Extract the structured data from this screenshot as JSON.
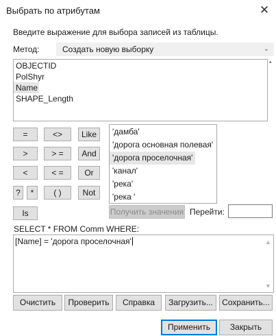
{
  "window": {
    "title": "Выбрать по атрибутам",
    "close_symbol": "✕"
  },
  "description": "Введите выражение для выбора записей из таблицы.",
  "method": {
    "label": "Метод:",
    "value": "Создать новую выборку"
  },
  "fields": {
    "items": [
      "OBJECTID",
      "PolShyr",
      "Name",
      "SHAPE_Length"
    ],
    "selected_index": 2
  },
  "operators": {
    "eq": "=",
    "ne": "<>",
    "like": "Like",
    "gt": ">",
    "ge": "> =",
    "and": "And",
    "lt": "<",
    "le": "< =",
    "or": "Or",
    "q": "?",
    "star": "*",
    "paren": "( )",
    "not": "Not",
    "is": "Is"
  },
  "values": {
    "items": [
      "'дамба'",
      "'дорога основная полевая'",
      "'дорога проселочная'",
      "'канал'",
      "'река'",
      "'река '"
    ],
    "selected_index": 2
  },
  "get_values_label": "Получить значения",
  "goto": {
    "label": "Перейти:",
    "value": ""
  },
  "sql_label": "SELECT * FROM Comm WHERE:",
  "expression": "[Name] = 'дорога проселочная'",
  "buttons": {
    "clear": "Очистить",
    "verify": "Проверить",
    "help": "Справка",
    "load": "Загрузить...",
    "save": "Сохранить...",
    "apply": "Применить",
    "close": "Закрыть"
  }
}
